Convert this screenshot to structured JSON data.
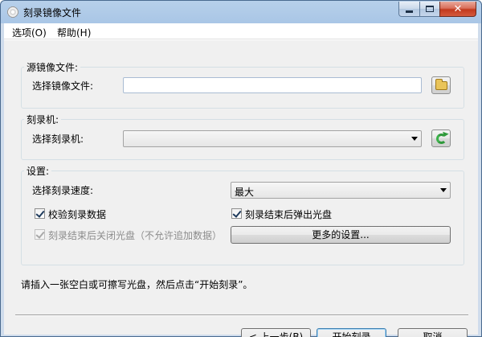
{
  "window": {
    "title": "刻录镜像文件"
  },
  "menu": {
    "options": "选项(O)",
    "help": "帮助(H)"
  },
  "source": {
    "group_title": "源镜像文件:",
    "label": "选择镜像文件:",
    "value": "",
    "browse_icon": "folder-icon"
  },
  "burner": {
    "group_title": "刻录机:",
    "label": "选择刻录机:",
    "selected": "",
    "refresh_icon": "refresh-icon"
  },
  "settings": {
    "group_title": "设置:",
    "speed_label": "选择刻录速度:",
    "speed_selected": "最大",
    "verify_label": "校验刻录数据",
    "verify_checked": true,
    "eject_label": "刻录结束后弹出光盘",
    "eject_checked": true,
    "close_disc_label": "刻录结束后关闭光盘（不允许追加数据）",
    "close_disc_checked": true,
    "close_disc_disabled": true,
    "more_settings_label": "更多的设置..."
  },
  "status_text": "请插入一张空白或可擦写光盘，然后点击“开始刻录”。",
  "buttons": {
    "back": "< 上一步(B)",
    "start": "开始刻录",
    "cancel": "取消"
  }
}
